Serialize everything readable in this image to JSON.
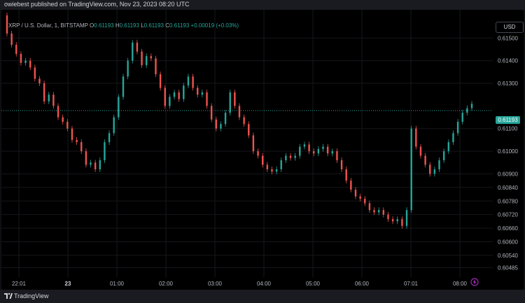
{
  "header": {
    "publisher_line": "owiebest published on TradingView.com, Nov 23, 2023 08:20 UTC"
  },
  "legend": {
    "symbol": "XRP / U.S. Dollar, 1, BITSTAMP",
    "o_label": "O",
    "o_value": "0.61193",
    "h_label": "H",
    "h_value": "0.61193",
    "l_label": "L",
    "l_value": "0.61193",
    "c_label": "C",
    "c_value": "0.61193",
    "change": "+0.00019 (+0.03%)"
  },
  "currency_button": "USD",
  "last_price": "0.61193",
  "footer": {
    "brand": "TradingView"
  },
  "colors": {
    "up": "#26a69a",
    "down": "#ef5350",
    "background": "#000000",
    "text": "#b2b5be"
  },
  "icons": [
    "tradingview-logo-icon",
    "lightning-icon"
  ],
  "chart_data": {
    "type": "candlestick",
    "title": "XRP / U.S. Dollar, 1, BITSTAMP",
    "ylim": [
      0.6045,
      0.616
    ],
    "y_ticks": [
      "0.61500",
      "0.61400",
      "0.61300",
      "0.61100",
      "0.61000",
      "0.60900",
      "0.60840",
      "0.60780",
      "0.60720",
      "0.60660",
      "0.60600",
      "0.60540",
      "0.60485"
    ],
    "x_ticks": [
      "22:01",
      "23",
      "01:00",
      "02:00",
      "03:00",
      "04:00",
      "05:00",
      "06:00",
      "07:01",
      "08:00"
    ],
    "x_ticks_bold": [
      "23"
    ],
    "last_price": 0.61193,
    "grid": true,
    "series": [
      {
        "points": [
          [
            0.616,
            0.6152
          ],
          [
            0.6152,
            0.6147
          ],
          [
            0.6147,
            0.6143
          ],
          [
            0.6143,
            0.6139
          ],
          [
            0.6139,
            0.614
          ],
          [
            0.614,
            0.6137
          ],
          [
            0.6137,
            0.6132
          ],
          [
            0.6132,
            0.613
          ],
          [
            0.613,
            0.6122
          ],
          [
            0.6122,
            0.6125
          ],
          [
            0.6125,
            0.612
          ],
          [
            0.612,
            0.6115
          ],
          [
            0.6115,
            0.6113
          ],
          [
            0.6113,
            0.611
          ],
          [
            0.611,
            0.6105
          ],
          [
            0.6105,
            0.6104
          ],
          [
            0.6104,
            0.61
          ],
          [
            0.61,
            0.6094
          ],
          [
            0.6094,
            0.6095
          ],
          [
            0.6095,
            0.6092
          ],
          [
            0.6092,
            0.6096
          ],
          [
            0.6096,
            0.6104
          ],
          [
            0.6104,
            0.6108
          ],
          [
            0.6108,
            0.6115
          ],
          [
            0.6115,
            0.6124
          ],
          [
            0.6124,
            0.6133
          ],
          [
            0.6133,
            0.614
          ],
          [
            0.614,
            0.6148
          ],
          [
            0.6148,
            0.6144
          ],
          [
            0.6144,
            0.6138
          ],
          [
            0.6138,
            0.6142
          ],
          [
            0.6142,
            0.6141
          ],
          [
            0.6141,
            0.6134
          ],
          [
            0.6134,
            0.6128
          ],
          [
            0.6128,
            0.612
          ],
          [
            0.612,
            0.6124
          ],
          [
            0.6124,
            0.6126
          ],
          [
            0.6126,
            0.6123
          ],
          [
            0.6123,
            0.6129
          ],
          [
            0.6129,
            0.6133
          ],
          [
            0.6133,
            0.6128
          ],
          [
            0.6128,
            0.6125
          ],
          [
            0.6125,
            0.6126
          ],
          [
            0.6126,
            0.612
          ],
          [
            0.612,
            0.6114
          ],
          [
            0.6114,
            0.611
          ],
          [
            0.611,
            0.6112
          ],
          [
            0.6112,
            0.6117
          ],
          [
            0.6117,
            0.6126
          ],
          [
            0.6126,
            0.612
          ],
          [
            0.612,
            0.6115
          ],
          [
            0.6115,
            0.6112
          ],
          [
            0.6112,
            0.6107
          ],
          [
            0.6107,
            0.61
          ],
          [
            0.61,
            0.6098
          ],
          [
            0.6098,
            0.6094
          ],
          [
            0.6094,
            0.6092
          ],
          [
            0.6092,
            0.6091
          ],
          [
            0.6091,
            0.6092
          ],
          [
            0.6092,
            0.6096
          ],
          [
            0.6096,
            0.6098
          ],
          [
            0.6098,
            0.6097
          ],
          [
            0.6097,
            0.6098
          ],
          [
            0.6098,
            0.6102
          ],
          [
            0.6102,
            0.6103
          ],
          [
            0.6103,
            0.61
          ],
          [
            0.61,
            0.6099
          ],
          [
            0.6099,
            0.6101
          ],
          [
            0.6101,
            0.6102
          ],
          [
            0.6102,
            0.6099
          ],
          [
            0.6099,
            0.61
          ],
          [
            0.61,
            0.6096
          ],
          [
            0.6096,
            0.6092
          ],
          [
            0.6092,
            0.6087
          ],
          [
            0.6087,
            0.6083
          ],
          [
            0.6083,
            0.608
          ],
          [
            0.608,
            0.6079
          ],
          [
            0.6079,
            0.6077
          ],
          [
            0.6077,
            0.6074
          ],
          [
            0.6074,
            0.6073
          ],
          [
            0.6073,
            0.6074
          ],
          [
            0.6074,
            0.6072
          ],
          [
            0.6072,
            0.607
          ],
          [
            0.607,
            0.6069
          ],
          [
            0.6069,
            0.607
          ],
          [
            0.607,
            0.6067
          ],
          [
            0.6067,
            0.6074
          ],
          [
            0.6074,
            0.611
          ],
          [
            0.611,
            0.6102
          ],
          [
            0.6102,
            0.6098
          ],
          [
            0.6098,
            0.6094
          ],
          [
            0.6094,
            0.609
          ],
          [
            0.609,
            0.6092
          ],
          [
            0.6092,
            0.6096
          ],
          [
            0.6096,
            0.61
          ],
          [
            0.61,
            0.6104
          ],
          [
            0.6104,
            0.6108
          ],
          [
            0.6108,
            0.6113
          ],
          [
            0.6113,
            0.6117
          ],
          [
            0.6117,
            0.6119
          ],
          [
            0.6119,
            0.6121
          ]
        ]
      }
    ]
  }
}
